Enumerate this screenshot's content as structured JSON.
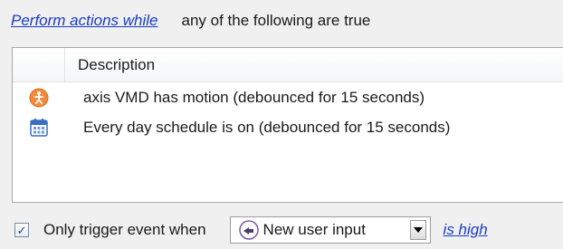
{
  "header": {
    "perform_link": "Perform actions while",
    "condition_text": "any of the following are true"
  },
  "table": {
    "column_description": "Description",
    "rows": [
      {
        "icon": "motion-person-icon",
        "text": "axis VMD has motion (debounced for 15 seconds)"
      },
      {
        "icon": "calendar-schedule-icon",
        "text": "Every day schedule is on (debounced for 15 seconds)"
      }
    ]
  },
  "footer": {
    "checkbox_checked": true,
    "check_mark": "✓",
    "checkbox_label": "Only trigger event when",
    "dropdown_value": "New user input",
    "state_link": "is high"
  },
  "colors": {
    "link": "#1a3cc8",
    "motion_icon": "#f28c3c",
    "calendar_icon": "#3a6ec0"
  }
}
